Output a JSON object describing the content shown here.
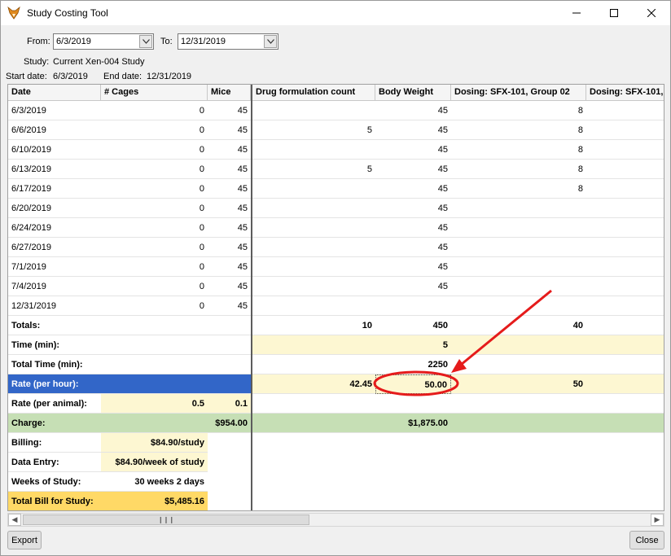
{
  "window": {
    "title": "Study Costing Tool"
  },
  "filters": {
    "from_label": "From:",
    "from_value": "6/3/2019",
    "to_label": "To:",
    "to_value": "12/31/2019"
  },
  "study": {
    "label": "Study:",
    "name": "Current Xen-004  Study",
    "start_label": "Start date:",
    "start_value": "6/3/2019",
    "end_label": "End date:",
    "end_value": "12/31/2019"
  },
  "columns": [
    "Date",
    "# Cages",
    "Mice",
    "Drug formulation count",
    "Body Weight",
    "Dosing: SFX-101, Group 02",
    "Dosing: SFX-101,"
  ],
  "rows": [
    [
      "6/3/2019",
      "0",
      "45",
      "",
      "45",
      "8",
      ""
    ],
    [
      "6/6/2019",
      "0",
      "45",
      "5",
      "45",
      "8",
      ""
    ],
    [
      "6/10/2019",
      "0",
      "45",
      "",
      "45",
      "8",
      ""
    ],
    [
      "6/13/2019",
      "0",
      "45",
      "5",
      "45",
      "8",
      ""
    ],
    [
      "6/17/2019",
      "0",
      "45",
      "",
      "45",
      "8",
      ""
    ],
    [
      "6/20/2019",
      "0",
      "45",
      "",
      "45",
      "",
      ""
    ],
    [
      "6/24/2019",
      "0",
      "45",
      "",
      "45",
      "",
      ""
    ],
    [
      "6/27/2019",
      "0",
      "45",
      "",
      "45",
      "",
      ""
    ],
    [
      "7/1/2019",
      "0",
      "45",
      "",
      "45",
      "",
      ""
    ],
    [
      "7/4/2019",
      "0",
      "45",
      "",
      "45",
      "",
      ""
    ],
    [
      "12/31/2019",
      "0",
      "45",
      "",
      "",
      "",
      ""
    ]
  ],
  "summary": {
    "totals": {
      "label": "Totals:",
      "drug": "10",
      "body": "450",
      "dosing": "40"
    },
    "time": {
      "label": "Time (min):",
      "body": "5"
    },
    "total_time": {
      "label": "Total Time (min):",
      "body": "2250"
    },
    "rate_hour": {
      "label": "Rate (per hour):",
      "drug": "42.45",
      "body": "50.00",
      "dosing": "50"
    },
    "rate_animal": {
      "label": "Rate (per animal):",
      "cages": "0.5",
      "mice": "0.1"
    },
    "charge": {
      "label": "Charge:",
      "left": "$954.00",
      "body": "$1,875.00"
    },
    "billing": {
      "label": "Billing:",
      "value": "$84.90/study"
    },
    "data_entry": {
      "label": "Data Entry:",
      "value": "$84.90/week of study"
    },
    "weeks": {
      "label": "Weeks of Study:",
      "value": "30 weeks 2 days"
    },
    "total_bill": {
      "label": "Total Bill for Study:",
      "value": "$5,485.16"
    }
  },
  "buttons": {
    "export": "Export",
    "close": "Close"
  },
  "icons": {
    "app": "fox-head-icon",
    "minimize": "minimize-icon",
    "maximize": "maximize-icon",
    "close": "close-icon",
    "dropdown": "chevron-down-icon"
  },
  "colors": {
    "rate_highlight": "#3266c8",
    "input_yellow": "#fdf7d2",
    "charge_green": "#c6dfb5",
    "total_gold": "#ffd966",
    "annotation_red": "#e51b1b"
  }
}
